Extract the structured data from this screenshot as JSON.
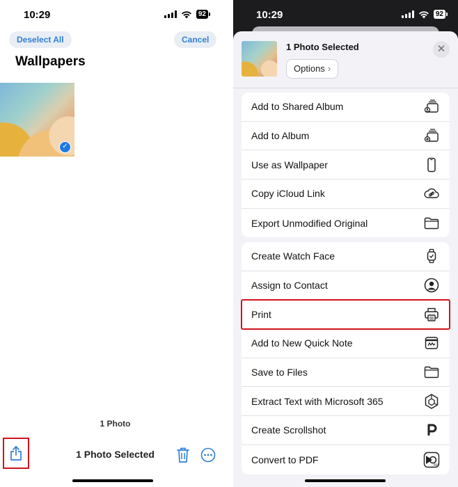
{
  "left": {
    "time": "10:29",
    "battery": "92",
    "deselect_label": "Deselect All",
    "cancel_label": "Cancel",
    "album_title": "Wallpapers",
    "count_label": "1 Photo",
    "toolbar_title": "1 Photo Selected"
  },
  "right": {
    "time": "10:29",
    "battery": "92",
    "sheet_title": "1 Photo Selected",
    "options_label": "Options",
    "group1": [
      {
        "label": "Add to Shared Album",
        "icon": "shared-album-icon"
      },
      {
        "label": "Add to Album",
        "icon": "add-album-icon"
      },
      {
        "label": "Use as Wallpaper",
        "icon": "phone-icon"
      },
      {
        "label": "Copy iCloud Link",
        "icon": "cloud-link-icon"
      },
      {
        "label": "Export Unmodified Original",
        "icon": "folder-icon"
      }
    ],
    "group2": [
      {
        "label": "Create Watch Face",
        "icon": "watch-icon"
      },
      {
        "label": "Assign to Contact",
        "icon": "contact-icon"
      },
      {
        "label": "Print",
        "icon": "printer-icon"
      },
      {
        "label": "Add to New Quick Note",
        "icon": "quick-note-icon"
      },
      {
        "label": "Save to Files",
        "icon": "folder-icon"
      },
      {
        "label": "Extract Text with Microsoft 365",
        "icon": "microsoft-365-icon"
      },
      {
        "label": "Create Scrollshot",
        "icon": "picsew-icon"
      },
      {
        "label": "Convert to PDF",
        "icon": "pdf-icon"
      }
    ]
  },
  "colors": {
    "accent_blue": "#2f7fd6",
    "highlight_red": "#d1121b",
    "sheet_bg": "#f2f2f7"
  }
}
